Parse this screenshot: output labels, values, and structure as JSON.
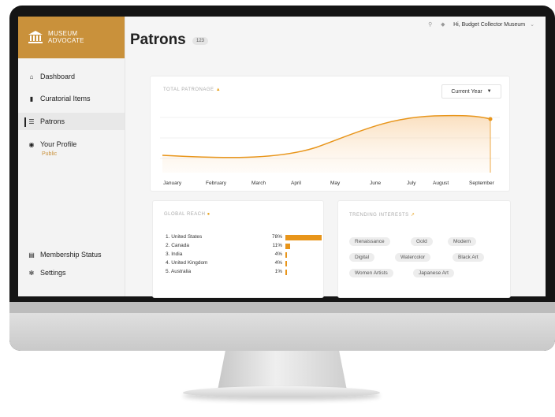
{
  "brand": {
    "line1": "MUSEUM",
    "line2": "ADVOCATE",
    "color": "#c9913b"
  },
  "nav": {
    "items": [
      {
        "label": "Dashboard",
        "icon": "home-icon"
      },
      {
        "label": "Curatorial Items",
        "icon": "chart-icon"
      },
      {
        "label": "Patrons",
        "icon": "patrons-icon",
        "active": true
      },
      {
        "label": "Your Profile",
        "icon": "profile-icon",
        "sub": "Public"
      }
    ],
    "bottom": [
      {
        "label": "Membership Status",
        "icon": "card-icon"
      },
      {
        "label": "Settings",
        "icon": "gear-icon"
      }
    ]
  },
  "topbar": {
    "greeting": "Hi, Budget Collector Museum"
  },
  "page": {
    "title": "Patrons",
    "count": "123"
  },
  "patronage": {
    "title": "TOTAL PATRONAGE",
    "period": "Current Year",
    "months": [
      "January",
      "February",
      "March",
      "April",
      "May",
      "June",
      "July",
      "August",
      "September"
    ]
  },
  "reach": {
    "title": "GLOBAL REACH",
    "rows": [
      {
        "name": "1. United States",
        "pct": "78%",
        "value": 78
      },
      {
        "name": "2. Canada",
        "pct": "11%",
        "value": 11
      },
      {
        "name": "3. India",
        "pct": "4%",
        "value": 4
      },
      {
        "name": "4. United Kingdom",
        "pct": "4%",
        "value": 4
      },
      {
        "name": "5. Australia",
        "pct": "1%",
        "value": 1
      }
    ]
  },
  "interests": {
    "title": "TRENDING INTERESTS",
    "tags": [
      "Renaissance",
      "Gold",
      "Modern",
      "Digital",
      "Watercolor",
      "Black Art",
      "Women Artists",
      "Japanese Art"
    ]
  },
  "colors": {
    "accent": "#e8951a",
    "brand": "#c9913b"
  }
}
